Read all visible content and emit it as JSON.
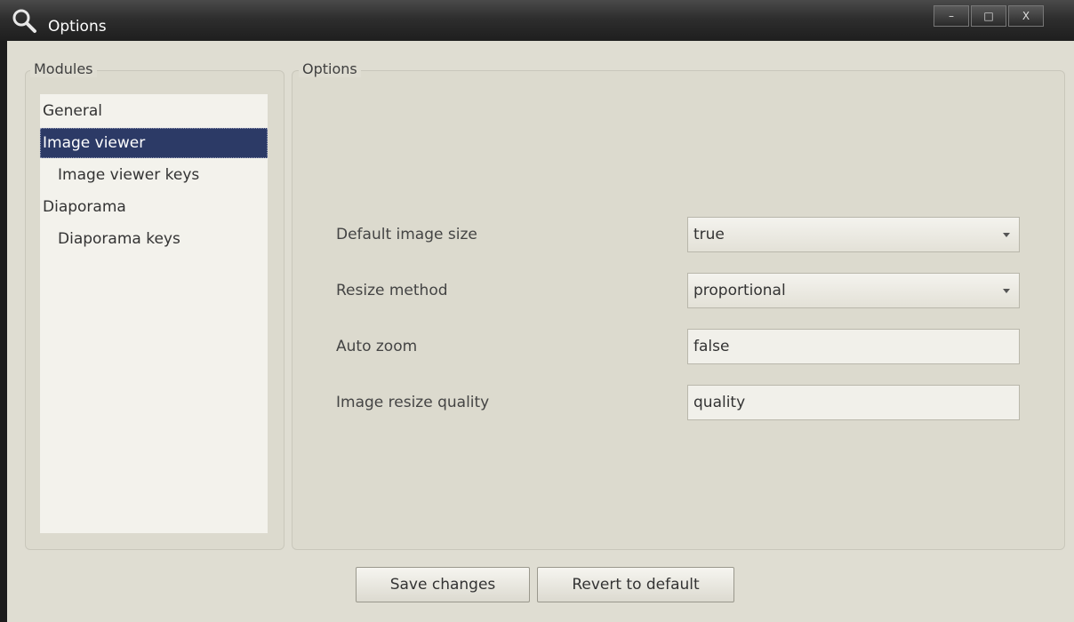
{
  "window": {
    "title": "Options",
    "app_icon": "magnifier-icon",
    "controls": [
      "minimize-icon",
      "maximize-icon",
      "close-icon"
    ],
    "control_glyphs": [
      "–",
      "□",
      "X"
    ]
  },
  "modules": {
    "group_title": "Modules",
    "items": [
      {
        "label": "General",
        "indent": 0,
        "selected": false
      },
      {
        "label": "Image viewer",
        "indent": 0,
        "selected": true
      },
      {
        "label": "Image viewer keys",
        "indent": 1,
        "selected": false
      },
      {
        "label": "Diaporama",
        "indent": 0,
        "selected": false
      },
      {
        "label": "Diaporama keys",
        "indent": 1,
        "selected": false
      }
    ]
  },
  "options": {
    "group_title": "Options",
    "fields": [
      {
        "label": "Default image size",
        "value": "true",
        "type": "combo"
      },
      {
        "label": "Resize method",
        "value": "proportional",
        "type": "combo"
      },
      {
        "label": "Auto zoom",
        "value": "false",
        "type": "text"
      },
      {
        "label": "Image resize quality",
        "value": "quality",
        "type": "text"
      }
    ]
  },
  "buttons": {
    "save_label": "Save changes",
    "revert_label": "Revert to default"
  },
  "colors": {
    "selection": "#2c3a66",
    "panel": "#dfddd2",
    "titlebar": "#2e2e2e"
  }
}
